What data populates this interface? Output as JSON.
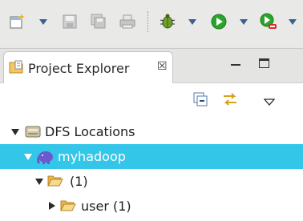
{
  "toolbar": {
    "icons": [
      "new-icon",
      "save-icon",
      "save-all-icon",
      "print-icon",
      "debug-icon",
      "run-icon",
      "run-config-icon"
    ]
  },
  "view": {
    "title": "Project Explorer",
    "close_glyph": "☒"
  },
  "tree": {
    "items": [
      {
        "label": "DFS Locations",
        "icon": "dfs-locations-icon",
        "expanded": true
      },
      {
        "label": "myhadoop",
        "icon": "hadoop-elephant-icon",
        "expanded": true,
        "selected": true
      },
      {
        "label": "(1)",
        "icon": "folder-icon",
        "expanded": true
      },
      {
        "label": "user (1)",
        "icon": "folder-icon",
        "expanded": false
      }
    ]
  },
  "colors": {
    "selection": "#34c6e8",
    "folder": "#f2c867",
    "run_green": "#2aa52a",
    "elephant": "#6a5acd"
  }
}
